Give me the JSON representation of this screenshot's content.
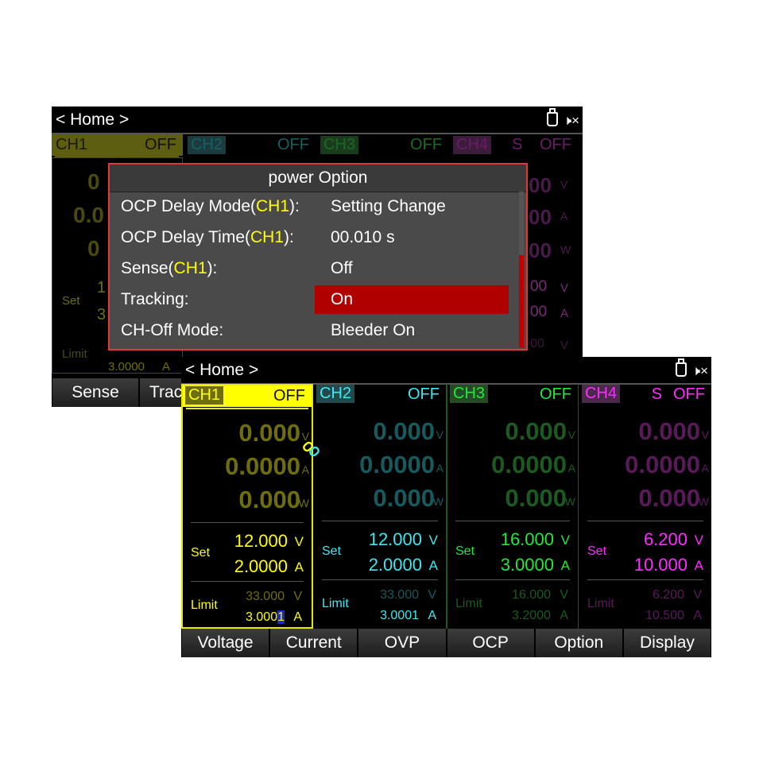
{
  "back_screen": {
    "header": {
      "title": "< Home >"
    },
    "channels": [
      {
        "name": "CH1",
        "state": "OFF"
      },
      {
        "name": "CH2",
        "state": "OFF"
      },
      {
        "name": "CH3",
        "state": "OFF"
      },
      {
        "name": "CH4",
        "sense": "S",
        "state": "OFF"
      }
    ],
    "ch1_partial": {
      "r1": "0",
      "r2": "0.0",
      "r3": "0",
      "set_label": "Set",
      "set_v": "1",
      "set_a": "3",
      "limit_label": "Limit",
      "limit_a": "3.0000",
      "limit_a_unit": "A"
    },
    "ch4_partial": {
      "r1": "00",
      "r1u": "V",
      "r2": "00",
      "r2u": "A",
      "r3": "00",
      "r3u": "W",
      "s1": "00",
      "s1u": "V",
      "s2": "00",
      "s2u": "A",
      "l1": "00",
      "l1u": "V"
    },
    "dialog": {
      "title": "power Option",
      "rows": [
        {
          "pre": "OCP Delay Mode(",
          "ch": "CH1",
          "post": "):",
          "value": "Setting Change"
        },
        {
          "pre": "OCP Delay Time(",
          "ch": "CH1",
          "post": "):",
          "value": "00.010 s"
        },
        {
          "pre": "Sense(",
          "ch": "CH1",
          "post": "):",
          "value": "Off"
        },
        {
          "pre": "Tracking:",
          "ch": "",
          "post": "",
          "value": "On"
        },
        {
          "pre": "CH-Off Mode:",
          "ch": "",
          "post": "",
          "value": "Bleeder On"
        }
      ]
    },
    "softkeys": [
      "Sense",
      "Trac"
    ]
  },
  "front_screen": {
    "header": {
      "title": "< Home >"
    },
    "channels": [
      {
        "name": "CH1",
        "sense": "",
        "state": "OFF",
        "voltage": "0.000",
        "current": "0.0000",
        "power": "0.000",
        "set_label": "Set",
        "set_v": "12.000",
        "set_a": "2.0000",
        "limit_label": "Limit",
        "limit_v": "33.000",
        "limit_a_main": "3.000",
        "limit_a_cursor": "1",
        "color": "#ffff00",
        "dim": "#6e6e10"
      },
      {
        "name": "CH2",
        "sense": "",
        "state": "OFF",
        "voltage": "0.000",
        "current": "0.0000",
        "power": "0.000",
        "set_label": "Set",
        "set_v": "12.000",
        "set_a": "2.0000",
        "limit_label": "Limit",
        "limit_v": "33.000",
        "limit_a": "3.0001",
        "color": "#3fe8f0",
        "dim": "#175a5e"
      },
      {
        "name": "CH3",
        "sense": "",
        "state": "OFF",
        "voltage": "0.000",
        "current": "0.0000",
        "power": "0.000",
        "set_label": "Set",
        "set_v": "16.000",
        "set_a": "3.0000",
        "limit_label": "Limit",
        "limit_v": "16.000",
        "limit_a": "3.2000",
        "color": "#22e838",
        "dim": "#1b5a20"
      },
      {
        "name": "CH4",
        "sense": "S",
        "state": "OFF",
        "voltage": "0.000",
        "current": "0.0000",
        "power": "0.000",
        "set_label": "Set",
        "set_v": "6.200",
        "set_a": "10.000",
        "limit_label": "Limit",
        "limit_v": "6.200",
        "limit_a": "10.500",
        "color": "#ff2cff",
        "dim": "#5a1a5a"
      }
    ],
    "units": {
      "v": "V",
      "a": "A",
      "w": "W"
    },
    "softkeys": [
      "Voltage",
      "Current",
      "OVP",
      "OCP",
      "Option",
      "Display"
    ]
  }
}
